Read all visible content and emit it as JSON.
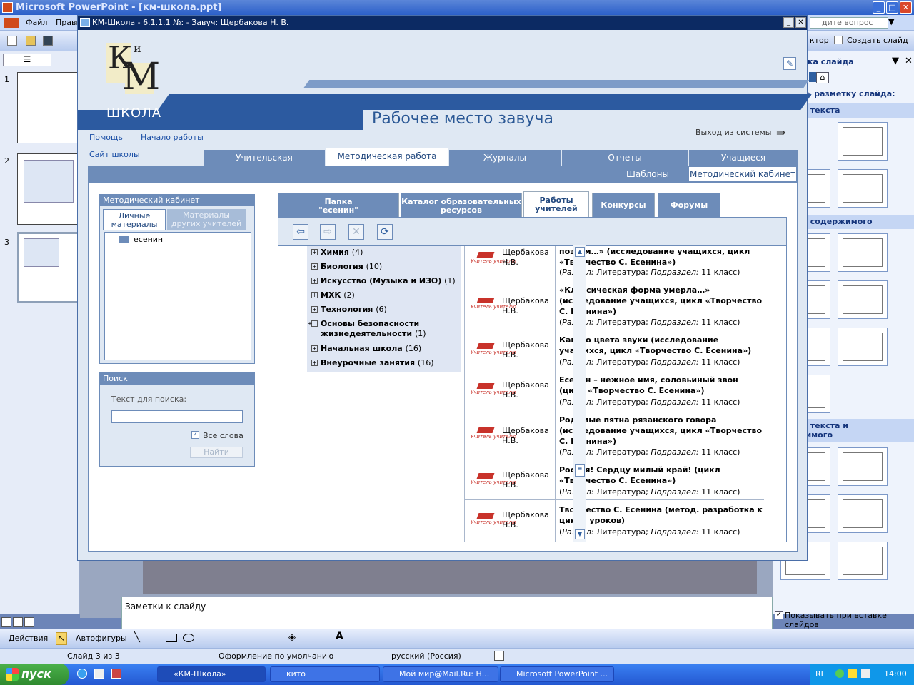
{
  "powerpoint": {
    "title": "Microsoft PowerPoint - [км-школа.ppt]",
    "menu": [
      "Файл",
      "Правк"
    ],
    "help_placeholder": "дите вопрос",
    "toolbar_right": [
      "ктор",
      "Создать слайд"
    ],
    "slide_numbers": [
      "1",
      "2",
      "3"
    ],
    "task_pane": {
      "title": "ка слайда",
      "apply_label": "ть разметку слайда:",
      "sections": [
        "ы текста",
        "ы содержимого",
        "ы текста и\nкимого"
      ],
      "show_on_insert": "Показывать при вставке слайдов"
    },
    "notes_placeholder": "Заметки к слайду",
    "draw_toolbar": {
      "actions": "Действия",
      "autoshapes": "Автофигуры"
    },
    "status": {
      "slide": "Слайд 3 из 3",
      "design": "Оформление по умолчанию",
      "language": "русский (Россия)"
    }
  },
  "taskbar": {
    "start": "пуск",
    "tasks": [
      "«КМ-Школа»",
      "кито",
      "Мой мир@Mail.Ru: Н...",
      "Microsoft PowerPoint ..."
    ],
    "lang": "RL",
    "clock": "14:00"
  },
  "km": {
    "window_title": "КМ-Школа - 6.1.1.1  №: -  Завуч: Щербакова Н. В.",
    "logo": {
      "letters_small": "К",
      "letters_big": "М",
      "sup": "и",
      "school": "ШКОЛА"
    },
    "page_title": "Рабочее место завуча",
    "links": {
      "help": "Помощь",
      "start": "Начало работы",
      "site": "Сайт школы",
      "logout": "Выход из системы"
    },
    "main_tabs": [
      "Учительская",
      "Методическая работа",
      "Журналы",
      "Отчеты",
      "Учащиеся"
    ],
    "sub_tabs": [
      "Шаблоны",
      "Методический кабинет"
    ],
    "left_panel": {
      "title": "Методический кабинет",
      "tabs": [
        "Личные\nматериалы",
        "Материалы\nдругих учителей"
      ],
      "folder": "есенин"
    },
    "search": {
      "title": "Поиск",
      "label": "Текст для поиска:",
      "value": "",
      "all_words": "Все слова",
      "all_words_checked": true,
      "button": "Найти"
    },
    "inner_tabs": [
      "Папка\n\"есенин\"",
      "Каталог образовательных\nресурсов",
      "Работы\nучителей",
      "Конкурсы",
      "Форумы"
    ],
    "toolbar_icons": [
      "back-arrow-icon",
      "forward-arrow-icon",
      "delete-icon",
      "refresh-icon"
    ],
    "tree": [
      {
        "label": "Химия",
        "count": "(4)"
      },
      {
        "label": "Биология",
        "count": "(10)"
      },
      {
        "label": "Искусство (Музыка и ИЗО)",
        "count": "(1)"
      },
      {
        "label": "МХК",
        "count": "(2)"
      },
      {
        "label": "Технология",
        "count": "(6)"
      },
      {
        "label": "Основы безопасности жизнедеятельности",
        "count": "(1)"
      },
      {
        "label": "Начальная школа",
        "count": "(16)"
      },
      {
        "label": "Внеурочные занятия",
        "count": "(16)"
      }
    ],
    "works": [
      {
        "author": "Щербакова Н.В.",
        "title": "поэтом…» (исследование учащихся, цикл «Творчество С. Есенина»)",
        "section_label": "Раздел:",
        "section": "Литература;",
        "subsection_label": "Подраздел:",
        "subsection": "11 класс)"
      },
      {
        "author": "Щербакова Н.В.",
        "title": "«Классическая форма умерла…» (исследование учащихся, цикл «Творчество С. Есенина»)",
        "section_label": "Раздел:",
        "section": "Литература;",
        "subsection_label": "Подраздел:",
        "subsection": "11 класс)"
      },
      {
        "author": "Щербакова Н.В.",
        "title": "Какого цвета звуки (исследование учащихся, цикл «Творчество С. Есенина»)",
        "section_label": "Раздел:",
        "section": "Литература;",
        "subsection_label": "Подраздел:",
        "subsection": "11 класс)"
      },
      {
        "author": "Щербакова Н.В.",
        "title": "Есенин – нежное имя, соловьиный звон (цикл «Творчество С. Есенина»)",
        "section_label": "Раздел:",
        "section": "Литература;",
        "subsection_label": "Подраздел:",
        "subsection": "11 класс)"
      },
      {
        "author": "Щербакова Н.В.",
        "title": "Родимые пятна рязанского говора (исследование учащихся, цикл «Творчество С. Есенина»)",
        "section_label": "Раздел:",
        "section": "Литература;",
        "subsection_label": "Подраздел:",
        "subsection": "11 класс)"
      },
      {
        "author": "Щербакова Н.В.",
        "title": "Россия! Сердцу милый край! (цикл «Творчество С. Есенина»)",
        "section_label": "Раздел:",
        "section": "Литература;",
        "subsection_label": "Подраздел:",
        "subsection": "11 класс)"
      },
      {
        "author": "Щербакова Н.В.",
        "title": "Творчество С. Есенина (метод. разработка к циклу уроков)",
        "section_label": "Раздел:",
        "section": "Литература;",
        "subsection_label": "Подраздел:",
        "subsection": "11 класс)"
      }
    ],
    "logo_badge": "Учитель учителю"
  }
}
